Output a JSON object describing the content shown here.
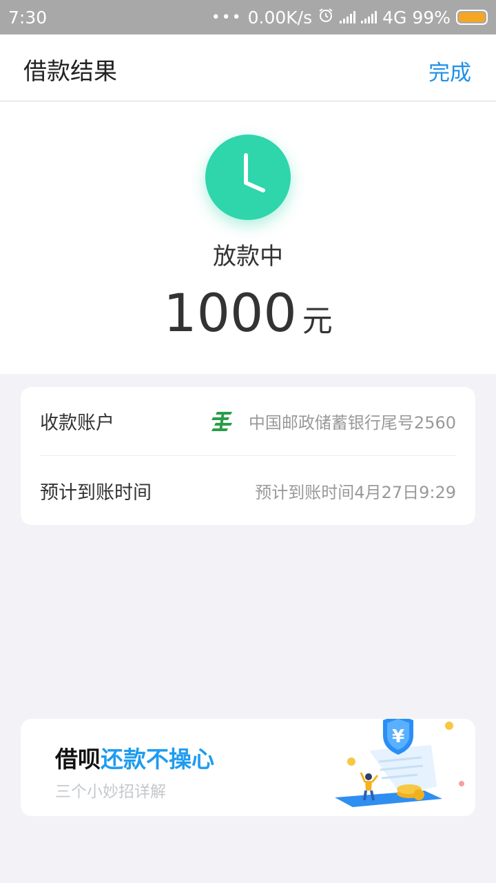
{
  "status_bar": {
    "time": "7:30",
    "dots": "•••",
    "speed": "0.00K/s",
    "network": "4G",
    "battery": "99%",
    "icons": [
      "alarm-icon",
      "signal-icon",
      "signal-icon",
      "battery-icon"
    ]
  },
  "header": {
    "title": "借款结果",
    "done_label": "完成"
  },
  "result": {
    "status": "放款中",
    "amount": "1000",
    "unit": "元",
    "icon": "clock-icon",
    "accent_color": "#2fd5ab"
  },
  "info": {
    "rows": [
      {
        "label": "收款账户",
        "value": "中国邮政储蓄银行尾号2560",
        "icon": "postal-bank-logo"
      },
      {
        "label": "预计到账时间",
        "value": "预计到账时间4月27日9:29"
      }
    ]
  },
  "promo": {
    "title_part1": "借呗",
    "title_part2": "还款不操心",
    "subtitle": "三个小妙招详解",
    "illustration_symbol": "¥",
    "title_accent_color": "#1e9cf0"
  },
  "colors": {
    "link": "#1e90e8",
    "background": "#f3f3f7",
    "bank_green": "#2a9d4a"
  }
}
